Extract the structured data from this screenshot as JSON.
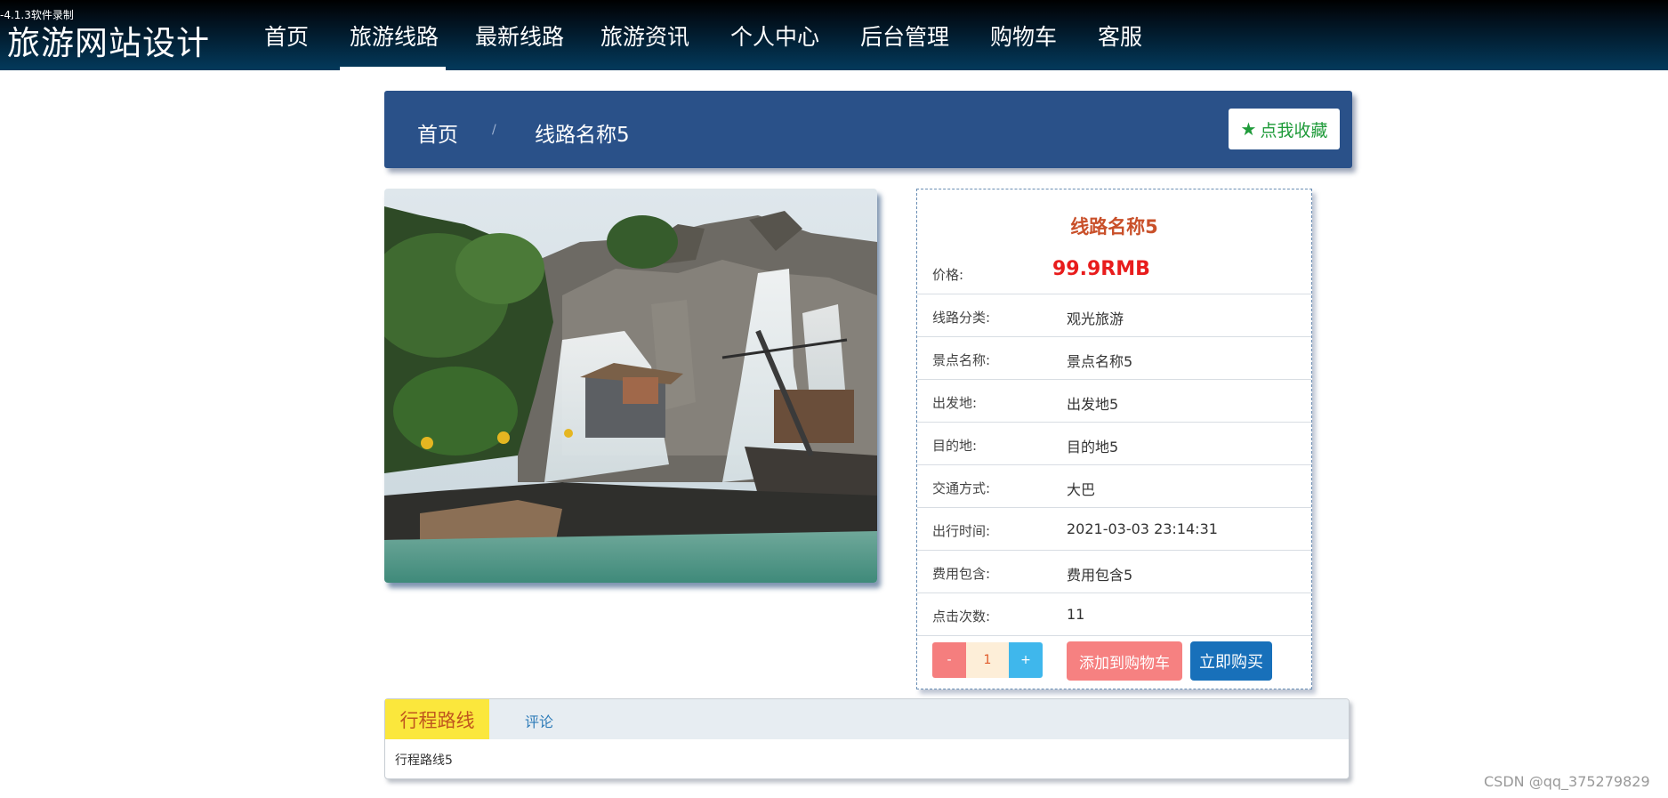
{
  "recorder_label": "-4.1.3软件录制",
  "site_title": "旅游网站设计",
  "nav": {
    "items": [
      "首页",
      "旅游线路",
      "最新线路",
      "旅游资讯",
      "个人中心",
      "后台管理",
      "购物车",
      "客服"
    ],
    "active": "旅游线路"
  },
  "breadcrumb": {
    "home": "首页",
    "separator": "/",
    "current": "线路名称5"
  },
  "favorite_button": {
    "label": "点我收藏",
    "icon": "star-icon"
  },
  "product": {
    "title": "线路名称5",
    "price_label": "价格:",
    "price": "99.9RMB",
    "details": [
      {
        "label": "线路分类:",
        "value": "观光旅游"
      },
      {
        "label": "景点名称:",
        "value": "景点名称5"
      },
      {
        "label": "出发地:",
        "value": "出发地5"
      },
      {
        "label": "目的地:",
        "value": "目的地5"
      },
      {
        "label": "交通方式:",
        "value": "大巴"
      },
      {
        "label": "出行时间:",
        "value": "2021-03-03 23:14:31"
      },
      {
        "label": "费用包含:",
        "value": "费用包含5"
      },
      {
        "label": "点击次数:",
        "value": "11"
      }
    ]
  },
  "quantity": {
    "minus": "-",
    "value": "1",
    "plus": "+"
  },
  "actions": {
    "add_to_cart": "添加到购物车",
    "buy_now": "立即购买"
  },
  "tabs": {
    "items": [
      "行程路线",
      "评论"
    ],
    "active": "行程路线",
    "content": "行程路线5"
  },
  "watermark": "CSDN @qq_375279829",
  "colors": {
    "nav_bg": "#033a5c",
    "banner_bg": "#2a5189",
    "price": "#e81c1c",
    "title": "#c9502a",
    "favorite": "#1f9b3a",
    "cart_button": "#f68181",
    "buy_button": "#1870ba",
    "tab_active": "#fbe73c"
  }
}
